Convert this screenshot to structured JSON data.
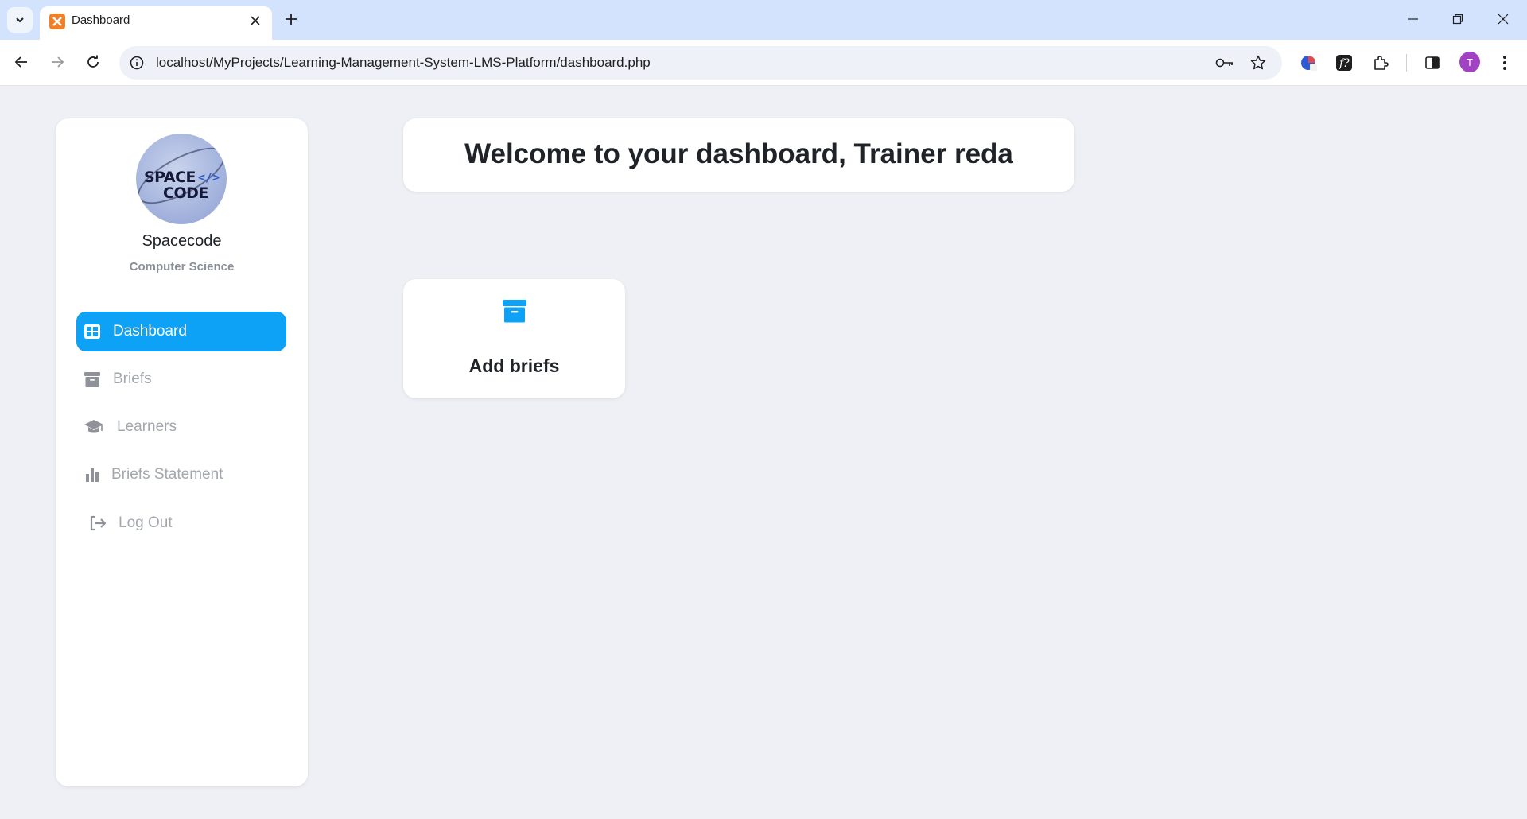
{
  "browser": {
    "tab_title": "Dashboard",
    "url": "localhost/MyProjects/Learning-Management-System-LMS-Platform/dashboard.php",
    "profile_initial": "T"
  },
  "sidebar": {
    "org_name": "Spacecode",
    "org_subtitle": "Computer Science",
    "logo_line1": "SPACE",
    "logo_line2": "CODE",
    "logo_code": "</>",
    "items": [
      {
        "label": "Dashboard",
        "icon": "grid-icon",
        "active": true
      },
      {
        "label": "Briefs",
        "icon": "archive-icon",
        "active": false
      },
      {
        "label": "Learners",
        "icon": "graduation-cap-icon",
        "active": false
      },
      {
        "label": "Briefs Statement",
        "icon": "bar-chart-icon",
        "active": false
      },
      {
        "label": "Log Out",
        "icon": "logout-icon",
        "active": false
      }
    ]
  },
  "main": {
    "welcome": "Welcome to your dashboard, Trainer reda",
    "cards": [
      {
        "label": "Add briefs",
        "icon": "archive-icon"
      }
    ]
  },
  "colors": {
    "accent": "#0ea2f6",
    "background": "#eef0f5",
    "muted_text": "#a3a7ae"
  }
}
